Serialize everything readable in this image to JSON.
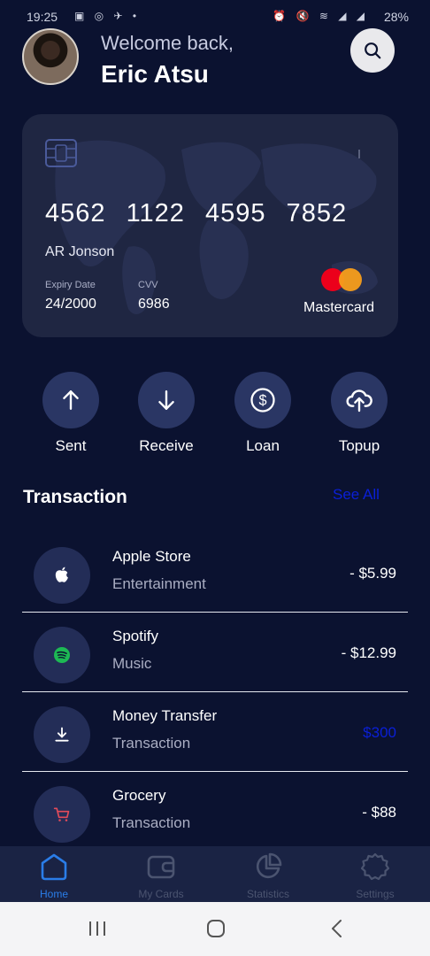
{
  "status_bar": {
    "time": "19:25",
    "left_icons": "▣ ◎ ✈ •",
    "right_icons": "⏰ 🔇 ≋ ◢ ◢",
    "battery": "28%"
  },
  "header": {
    "welcome": "Welcome back,",
    "user_name": "Eric Atsu"
  },
  "card": {
    "number": "4562 1122 4595 7852",
    "holder": "AR Jonson",
    "expiry_label": "Expiry Date",
    "expiry_value": "24/2000",
    "cvv_label": "CVV",
    "cvv_value": "6986",
    "brand": "Mastercard",
    "brand_colors": [
      "#eb001b",
      "#f79e1b"
    ]
  },
  "actions": [
    {
      "label": "Sent",
      "icon": "arrow-up-icon"
    },
    {
      "label": "Receive",
      "icon": "arrow-down-icon"
    },
    {
      "label": "Loan",
      "icon": "dollar-icon"
    },
    {
      "label": "Topup",
      "icon": "cloud-upload-icon"
    }
  ],
  "transactions": {
    "title": "Transaction",
    "see_all": "See All",
    "items": [
      {
        "name": "Apple Store",
        "category": "Entertainment",
        "amount": "- $5.99",
        "icon": "apple-icon"
      },
      {
        "name": "Spotify",
        "category": "Music",
        "amount": "- $12.99",
        "icon": "spotify-icon"
      },
      {
        "name": "Money Transfer",
        "category": "Transaction",
        "amount": "$300",
        "icon": "download-icon"
      },
      {
        "name": "Grocery",
        "category": "Transaction",
        "amount": "- $88",
        "icon": "cart-icon"
      }
    ]
  },
  "bottom_nav": {
    "items": [
      {
        "label": "Home",
        "icon": "home-icon",
        "active": true
      },
      {
        "label": "My Cards",
        "icon": "wallet-icon",
        "active": false
      },
      {
        "label": "Statistics",
        "icon": "pie-chart-icon",
        "active": false
      },
      {
        "label": "Settings",
        "icon": "gear-icon",
        "active": false
      }
    ]
  },
  "colors": {
    "background": "#0b1230",
    "card": "#1f2642",
    "accent": "#2a7de8",
    "link": "#0a1fd8"
  }
}
